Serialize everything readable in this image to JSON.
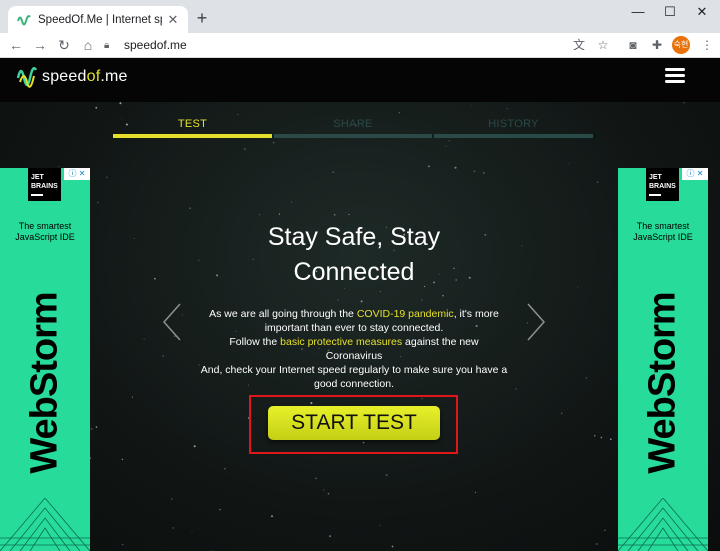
{
  "browser": {
    "tab_title": "SpeedOf.Me | Internet speed te",
    "url": "speedof.me",
    "profile_initials": "숙현"
  },
  "site": {
    "logo_pre": "speed",
    "logo_of": "of",
    "logo_post": ".me",
    "steps": [
      {
        "label": "TEST",
        "active": true
      },
      {
        "label": "SHARE",
        "active": false
      },
      {
        "label": "HISTORY",
        "active": false
      }
    ],
    "heading": "Stay Safe, Stay Connected",
    "para": {
      "line1a": "As we are all going through the ",
      "covid": "COVID-19 pandemic",
      "line1b": ", it's more important than ever to stay connected.",
      "line2a": "Follow the ",
      "measures": "basic protective measures",
      "line2b": " against the new Coronavirus",
      "line3": "And, check your Internet speed regularly to make sure you have a good connection."
    },
    "start_button": "START TEST"
  },
  "ads": {
    "brand_line1": "JET",
    "brand_line2": "BRAINS",
    "tagline_line1": "The smartest",
    "tagline_line2": "JavaScript IDE",
    "product": "WebStorm"
  },
  "colors": {
    "accent": "#e4e02a",
    "inactive_step": "#2a4a47",
    "ad_green": "#27dc9a",
    "highlight_red": "#e0161b"
  }
}
